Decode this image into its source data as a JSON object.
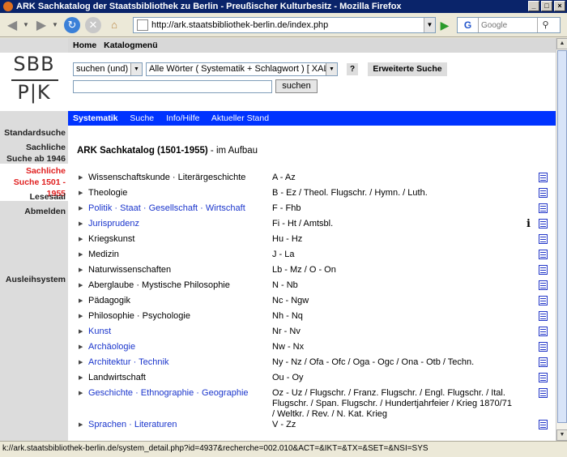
{
  "browser": {
    "title": "ARK Sachkatalog der Staatsbibliothek zu Berlin - Preußischer Kulturbesitz - Mozilla Firefox",
    "url": "http://ark.staatsbibliothek-berlin.de/index.php",
    "search_placeholder": "Google",
    "search_engine_icon": "G",
    "status_text": "k://ark.staatsbibliothek-berlin.de/system_detail.php?id=4937&recherche=002.010&ACT=&IKT=&TX=&SET=&NSI=SYS"
  },
  "logo": {
    "line1": "SBB",
    "line2": "P|K"
  },
  "topnav": {
    "items": [
      "Home",
      "Katalogmenü"
    ]
  },
  "form": {
    "mode_value": "suchen (und)",
    "field_value": "Alle Wörter ( Systematik + Schlagwort ) [ XAL ]",
    "help_label": "?",
    "advanced_label": "Erweiterte Suche",
    "submit_label": "suchen"
  },
  "tabs": [
    "Systematik",
    "Suche",
    "Info/Hilfe",
    "Aktueller Stand"
  ],
  "left_nav": {
    "items": [
      {
        "label": "Standardsuche",
        "active": false
      },
      {
        "label": "Sachliche Suche ab 1946",
        "active": false
      },
      {
        "label": "Sachliche Suche 1501 - 1955",
        "active": true
      },
      {
        "label": "Lesesaal",
        "active": false
      },
      {
        "label": "Abmelden",
        "active": false
      },
      {
        "label": "Ausleihsystem",
        "active": false
      }
    ]
  },
  "heading": {
    "title": "ARK Sachkatalog (1501-1955)",
    "suffix": " - im Aufbau"
  },
  "catalog": [
    {
      "subject": "Wissenschaftskunde · Literärgeschichte",
      "link": false,
      "code": "A - Az",
      "info": false
    },
    {
      "subject": "Theologie",
      "link": false,
      "code": "B - Ez / Theol. Flugschr. / Hymn. / Luth.",
      "info": false
    },
    {
      "subject": "Politik · Staat · Gesellschaft · Wirtschaft",
      "link": true,
      "code": "F - Fhb",
      "info": false
    },
    {
      "subject": "Jurisprudenz",
      "link": true,
      "code": "Fi - Ht / Amtsbl.",
      "info": true
    },
    {
      "subject": "Kriegskunst",
      "link": false,
      "code": "Hu - Hz",
      "info": false
    },
    {
      "subject": "Medizin",
      "link": false,
      "code": "J - La",
      "info": false
    },
    {
      "subject": "Naturwissenschaften",
      "link": false,
      "code": "Lb - Mz / O - On",
      "info": false
    },
    {
      "subject": "Aberglaube · Mystische Philosophie",
      "link": false,
      "code": "N - Nb",
      "info": false
    },
    {
      "subject": "Pädagogik",
      "link": false,
      "code": "Nc - Ngw",
      "info": false
    },
    {
      "subject": "Philosophie · Psychologie",
      "link": false,
      "code": "Nh - Nq",
      "info": false
    },
    {
      "subject": "Kunst",
      "link": true,
      "code": "Nr - Nv",
      "info": false
    },
    {
      "subject": "Archäologie",
      "link": true,
      "code": "Nw - Nx",
      "info": false
    },
    {
      "subject": "Architektur · Technik",
      "link": true,
      "code": "Ny - Nz / Ofa - Ofc / Oga - Ogc / Ona - Otb / Techn.",
      "info": false
    },
    {
      "subject": "Landwirtschaft",
      "link": false,
      "code": "Ou - Oy",
      "info": false
    },
    {
      "subject": "Geschichte · Ethnographie · Geographie",
      "link": true,
      "code": "Oz - Uz / Flugschr. / Franz. Flugschr. / Engl. Flugschr. / Ital. Flugschr. / Span. Flugschr. / Hundertjahrfeier / Krieg 1870/71 / Weltkr. / Rev. / N. Kat. Krieg",
      "info": false
    },
    {
      "subject": "Sprachen · Literaturen",
      "link": true,
      "code": "V - Zz",
      "info": false
    }
  ],
  "colors": {
    "accent_blue": "#0033ff",
    "link": "#1a35cc",
    "active_nav": "#e02020",
    "titlebar": "#0a246a"
  },
  "info_glyph": "i"
}
